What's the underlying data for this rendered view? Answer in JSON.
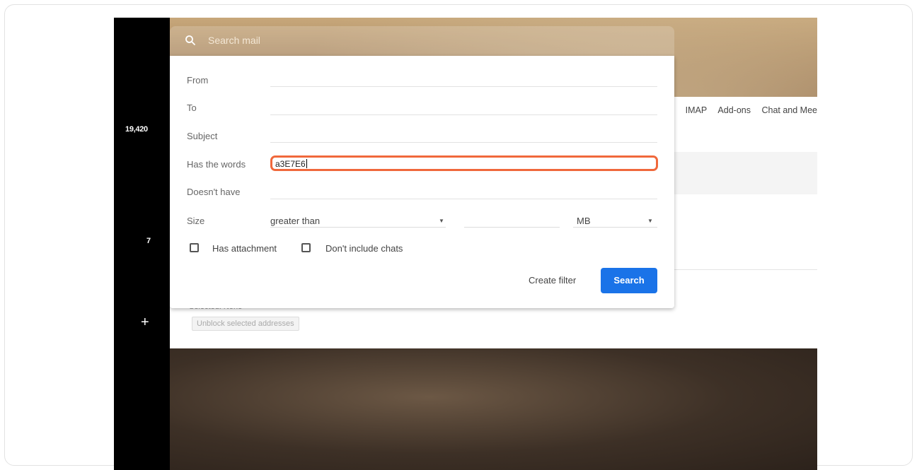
{
  "rail": {
    "count": "19,420",
    "number": "7",
    "plus": "+"
  },
  "search": {
    "placeholder": "Search mail"
  },
  "settings_tabs": [
    "IMAP",
    "Add-ons",
    "Chat and Mee"
  ],
  "blocked": {
    "label": "Selected: None",
    "unblock_label": "Unblock selected addresses"
  },
  "form": {
    "from_label": "From",
    "to_label": "To",
    "subject_label": "Subject",
    "has_words_label": "Has the words",
    "has_words_value": "a3E7E6",
    "doesnt_have_label": "Doesn't have",
    "size_label": "Size",
    "size_operator": "greater than",
    "size_unit": "MB",
    "has_attachment_label": "Has attachment",
    "exclude_chats_label": "Don't include chats",
    "create_filter_label": "Create filter",
    "search_label": "Search"
  },
  "colors": {
    "highlight": "#f0683b",
    "primary": "#1a73e8"
  }
}
